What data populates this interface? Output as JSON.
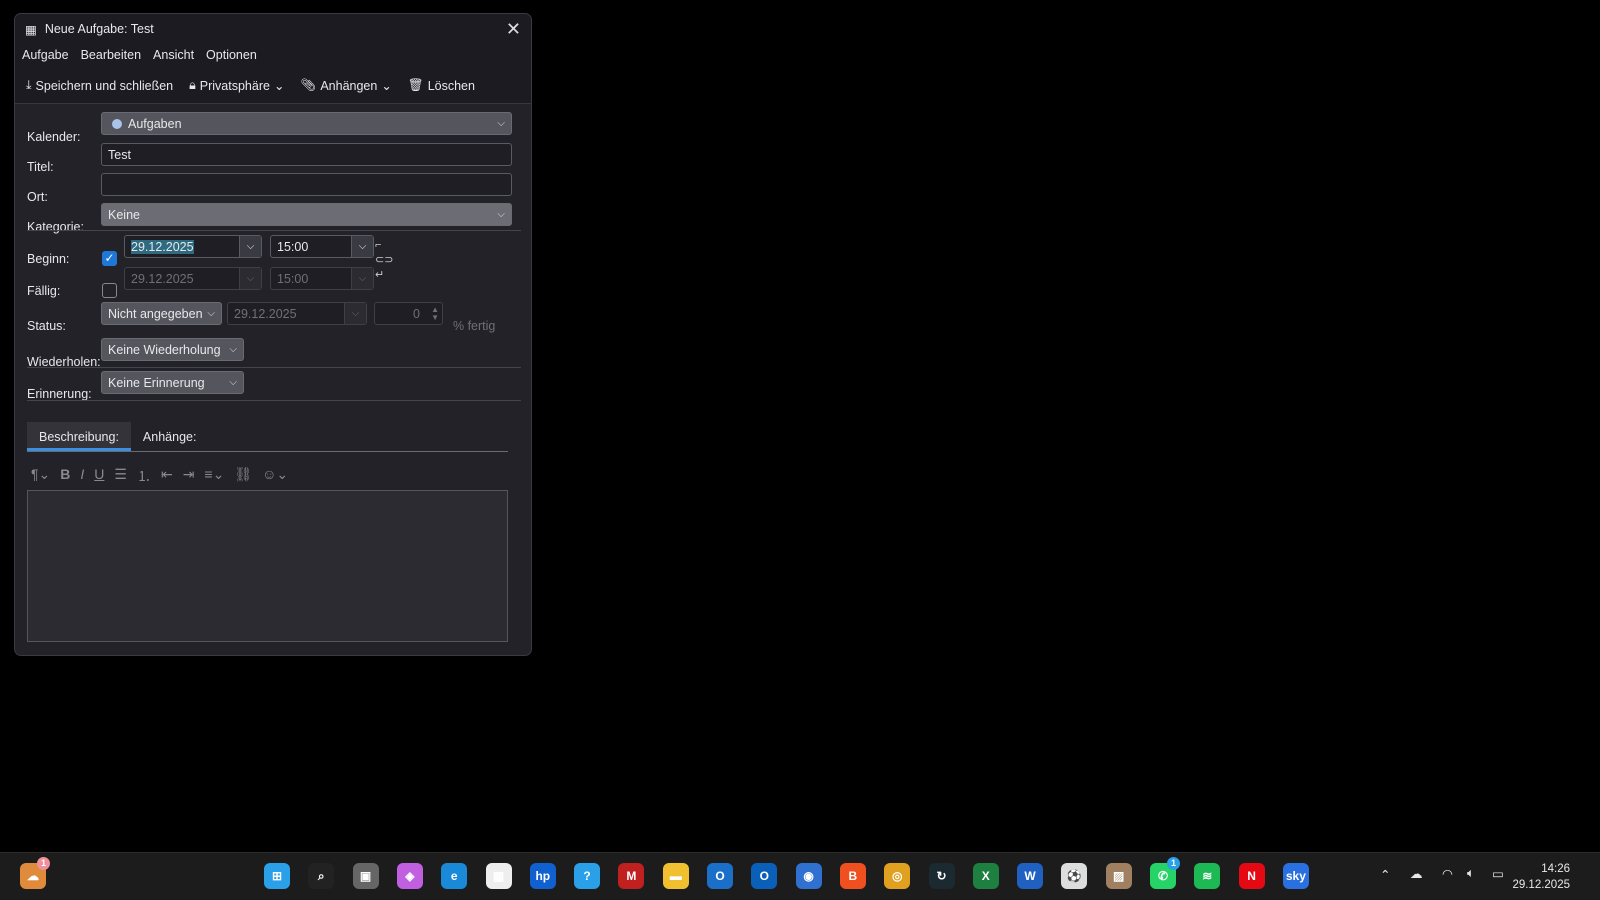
{
  "window": {
    "title": "Neue Aufgabe: Test",
    "close": "✕"
  },
  "menu": [
    "Aufgabe",
    "Bearbeiten",
    "Ansicht",
    "Optionen"
  ],
  "toolbar": {
    "save": "Speichern und schließen",
    "privacy": "Privatsphäre",
    "attach": "Anhängen",
    "delete": "Löschen"
  },
  "form": {
    "calendar_label": "Kalender:",
    "calendar_value": "Aufgaben",
    "calendar_color": "#a8c4e8",
    "title_label": "Titel:",
    "title_value": "Test",
    "location_label": "Ort:",
    "location_value": "",
    "category_label": "Kategorie:",
    "category_value": "Keine",
    "start_label": "Beginn:",
    "start_checked": true,
    "start_date": "29.12.2025",
    "start_time": "15:00",
    "due_label": "Fällig:",
    "due_checked": false,
    "due_date": "29.12.2025",
    "due_time": "15:00",
    "status_label": "Status:",
    "status_value": "Nicht angegeben",
    "status_date": "29.12.2025",
    "percent": "0",
    "percent_label": "% fertig",
    "repeat_label": "Wiederholen:",
    "repeat_value": "Keine Wiederholung",
    "reminder_label": "Erinnerung:",
    "reminder_value": "Keine Erinnerung"
  },
  "tabs": [
    "Beschreibung:",
    "Anhänge:"
  ],
  "description": "",
  "taskbar": {
    "time": "14:26",
    "date": "29.12.2025",
    "badges": {
      "weather": "1",
      "whatsapp": "1"
    },
    "apps": [
      "Windows",
      "Search",
      "Task View",
      "Copilot",
      "Edge",
      "Store",
      "HP",
      "Help",
      "McAfee",
      "Explorer",
      "Outlook (new)",
      "Outlook",
      "Thunderbird",
      "Brave",
      "Chrome",
      "Speedtest",
      "Excel",
      "Word",
      "Football",
      "Photos",
      "WhatsApp",
      "Spotify",
      "Netflix",
      "Sky"
    ]
  }
}
